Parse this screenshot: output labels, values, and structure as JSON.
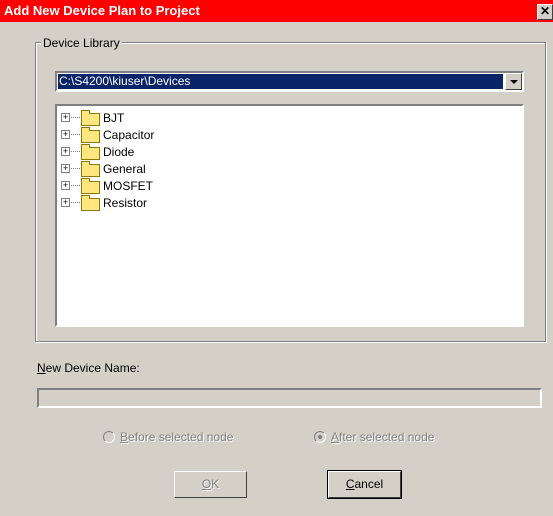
{
  "window": {
    "title": "Add New Device Plan to Project",
    "close_glyph": "✕"
  },
  "device_library": {
    "group_label": "Device Library",
    "path_value": "C:\\S4200\\kiuser\\Devices",
    "tree_items": [
      {
        "label": "BJT",
        "icon": "folder-icon",
        "expander": "+"
      },
      {
        "label": "Capacitor",
        "icon": "folder-icon",
        "expander": "+"
      },
      {
        "label": "Diode",
        "icon": "folder-icon",
        "expander": "+"
      },
      {
        "label": "General",
        "icon": "folder-icon",
        "expander": "+"
      },
      {
        "label": "MOSFET",
        "icon": "folder-icon",
        "expander": "+"
      },
      {
        "label": "Resistor",
        "icon": "folder-icon",
        "expander": "+"
      }
    ]
  },
  "new_device": {
    "label_first": "N",
    "label_rest": "ew Device Name:",
    "value": ""
  },
  "placement": {
    "before_first": "B",
    "before_rest": "efore selected node",
    "before_selected": false,
    "after_first": "A",
    "after_rest": "fter selected node",
    "after_selected": true
  },
  "buttons": {
    "ok_first": "O",
    "ok_rest": "K",
    "cancel_first": "C",
    "cancel_rest": "ancel"
  },
  "colors": {
    "title_bar": "#ff0000",
    "selection": "#0a246a",
    "dialog_bg": "#d4d0c8"
  }
}
